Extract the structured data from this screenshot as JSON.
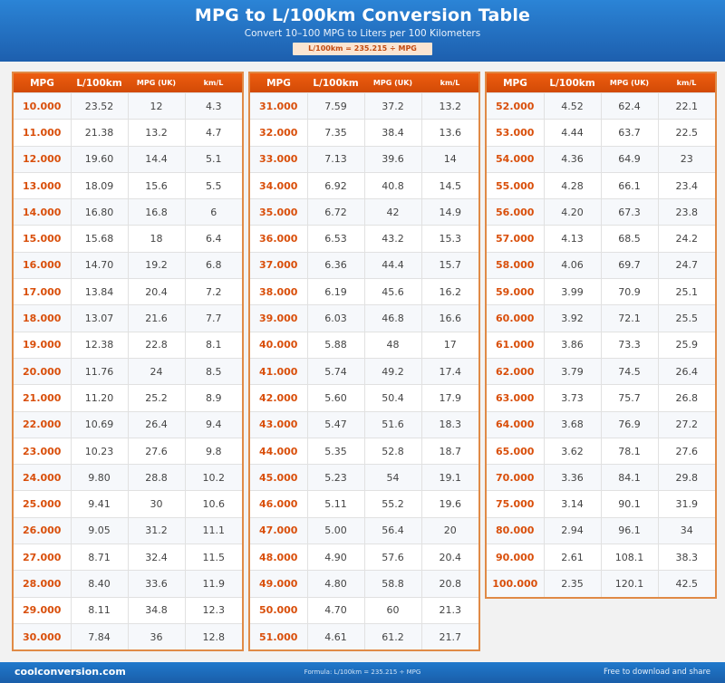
{
  "header": {
    "title": "MPG to L/100km Conversion Table",
    "subtitle": "Convert 10–100 MPG to Liters per 100 Kilometers",
    "formula": "L/100km = 235.215 ÷ MPG"
  },
  "columns_headers": [
    "MPG",
    "L/100km",
    "MPG (UK)",
    "km/L"
  ],
  "tables": [
    {
      "rows": [
        [
          "10.000",
          "23.52",
          "12",
          "4.3"
        ],
        [
          "11.000",
          "21.38",
          "13.2",
          "4.7"
        ],
        [
          "12.000",
          "19.60",
          "14.4",
          "5.1"
        ],
        [
          "13.000",
          "18.09",
          "15.6",
          "5.5"
        ],
        [
          "14.000",
          "16.80",
          "16.8",
          "6"
        ],
        [
          "15.000",
          "15.68",
          "18",
          "6.4"
        ],
        [
          "16.000",
          "14.70",
          "19.2",
          "6.8"
        ],
        [
          "17.000",
          "13.84",
          "20.4",
          "7.2"
        ],
        [
          "18.000",
          "13.07",
          "21.6",
          "7.7"
        ],
        [
          "19.000",
          "12.38",
          "22.8",
          "8.1"
        ],
        [
          "20.000",
          "11.76",
          "24",
          "8.5"
        ],
        [
          "21.000",
          "11.20",
          "25.2",
          "8.9"
        ],
        [
          "22.000",
          "10.69",
          "26.4",
          "9.4"
        ],
        [
          "23.000",
          "10.23",
          "27.6",
          "9.8"
        ],
        [
          "24.000",
          "9.80",
          "28.8",
          "10.2"
        ],
        [
          "25.000",
          "9.41",
          "30",
          "10.6"
        ],
        [
          "26.000",
          "9.05",
          "31.2",
          "11.1"
        ],
        [
          "27.000",
          "8.71",
          "32.4",
          "11.5"
        ],
        [
          "28.000",
          "8.40",
          "33.6",
          "11.9"
        ],
        [
          "29.000",
          "8.11",
          "34.8",
          "12.3"
        ],
        [
          "30.000",
          "7.84",
          "36",
          "12.8"
        ]
      ]
    },
    {
      "rows": [
        [
          "31.000",
          "7.59",
          "37.2",
          "13.2"
        ],
        [
          "32.000",
          "7.35",
          "38.4",
          "13.6"
        ],
        [
          "33.000",
          "7.13",
          "39.6",
          "14"
        ],
        [
          "34.000",
          "6.92",
          "40.8",
          "14.5"
        ],
        [
          "35.000",
          "6.72",
          "42",
          "14.9"
        ],
        [
          "36.000",
          "6.53",
          "43.2",
          "15.3"
        ],
        [
          "37.000",
          "6.36",
          "44.4",
          "15.7"
        ],
        [
          "38.000",
          "6.19",
          "45.6",
          "16.2"
        ],
        [
          "39.000",
          "6.03",
          "46.8",
          "16.6"
        ],
        [
          "40.000",
          "5.88",
          "48",
          "17"
        ],
        [
          "41.000",
          "5.74",
          "49.2",
          "17.4"
        ],
        [
          "42.000",
          "5.60",
          "50.4",
          "17.9"
        ],
        [
          "43.000",
          "5.47",
          "51.6",
          "18.3"
        ],
        [
          "44.000",
          "5.35",
          "52.8",
          "18.7"
        ],
        [
          "45.000",
          "5.23",
          "54",
          "19.1"
        ],
        [
          "46.000",
          "5.11",
          "55.2",
          "19.6"
        ],
        [
          "47.000",
          "5.00",
          "56.4",
          "20"
        ],
        [
          "48.000",
          "4.90",
          "57.6",
          "20.4"
        ],
        [
          "49.000",
          "4.80",
          "58.8",
          "20.8"
        ],
        [
          "50.000",
          "4.70",
          "60",
          "21.3"
        ],
        [
          "51.000",
          "4.61",
          "61.2",
          "21.7"
        ]
      ]
    },
    {
      "rows": [
        [
          "52.000",
          "4.52",
          "62.4",
          "22.1"
        ],
        [
          "53.000",
          "4.44",
          "63.7",
          "22.5"
        ],
        [
          "54.000",
          "4.36",
          "64.9",
          "23"
        ],
        [
          "55.000",
          "4.28",
          "66.1",
          "23.4"
        ],
        [
          "56.000",
          "4.20",
          "67.3",
          "23.8"
        ],
        [
          "57.000",
          "4.13",
          "68.5",
          "24.2"
        ],
        [
          "58.000",
          "4.06",
          "69.7",
          "24.7"
        ],
        [
          "59.000",
          "3.99",
          "70.9",
          "25.1"
        ],
        [
          "60.000",
          "3.92",
          "72.1",
          "25.5"
        ],
        [
          "61.000",
          "3.86",
          "73.3",
          "25.9"
        ],
        [
          "62.000",
          "3.79",
          "74.5",
          "26.4"
        ],
        [
          "63.000",
          "3.73",
          "75.7",
          "26.8"
        ],
        [
          "64.000",
          "3.68",
          "76.9",
          "27.2"
        ],
        [
          "65.000",
          "3.62",
          "78.1",
          "27.6"
        ],
        [
          "70.000",
          "3.36",
          "84.1",
          "29.8"
        ],
        [
          "75.000",
          "3.14",
          "90.1",
          "31.9"
        ],
        [
          "80.000",
          "2.94",
          "96.1",
          "34"
        ],
        [
          "90.000",
          "2.61",
          "108.1",
          "38.3"
        ],
        [
          "100.000",
          "2.35",
          "120.1",
          "42.5"
        ]
      ]
    }
  ],
  "footer": {
    "brand": "coolconversion.com",
    "formula_note": "Formula: L/100km = 235.215 ÷ MPG",
    "download": "Free to download and share"
  },
  "colors": {
    "header_blue": "#1f6fc4",
    "accent_orange": "#e1550c",
    "mpg_text": "#d94f0b"
  }
}
